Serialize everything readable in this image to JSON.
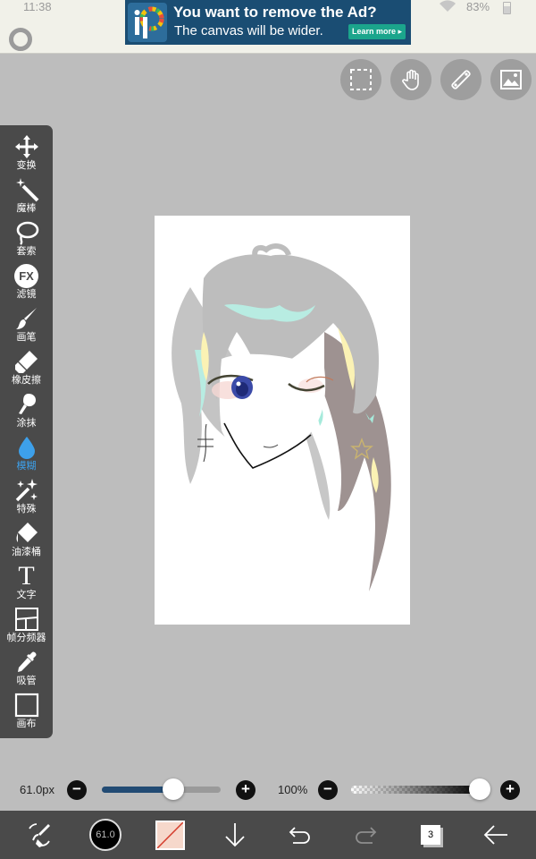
{
  "status_bar": {
    "time": "11:38",
    "battery": "83%"
  },
  "ad": {
    "title": "You want to remove the Ad?",
    "subtitle": "The canvas will be wider.",
    "button": "Learn more ▸"
  },
  "top_buttons": [
    {
      "name": "selection",
      "icon": "dashed-square-icon"
    },
    {
      "name": "gesture",
      "icon": "hand-icon"
    },
    {
      "name": "ruler",
      "icon": "ruler-icon"
    },
    {
      "name": "material",
      "icon": "image-icon"
    }
  ],
  "toolbar": {
    "items": [
      {
        "label": "变换",
        "icon": "move-arrows-icon"
      },
      {
        "label": "魔棒",
        "icon": "magic-wand-icon"
      },
      {
        "label": "套索",
        "icon": "lasso-icon"
      },
      {
        "label": "滤镜",
        "icon": "fx-icon",
        "icon_text": "FX"
      },
      {
        "label": "画笔",
        "icon": "brush-icon"
      },
      {
        "label": "橡皮擦",
        "icon": "eraser-icon"
      },
      {
        "label": "涂抹",
        "icon": "smudge-icon"
      },
      {
        "label": "模糊",
        "icon": "blur-drop-icon",
        "active": true
      },
      {
        "label": "特殊",
        "icon": "sparkle-icon"
      },
      {
        "label": "油漆桶",
        "icon": "bucket-icon"
      },
      {
        "label": "文字",
        "icon": "text-icon",
        "icon_text": "T"
      },
      {
        "label": "帧分频器",
        "icon": "frame-divider-icon"
      },
      {
        "label": "吸管",
        "icon": "eyedropper-icon"
      },
      {
        "label": "画布",
        "icon": "canvas-icon"
      }
    ],
    "active_color": "#3da0ea"
  },
  "brush_settings": {
    "size_label": "61.0px",
    "size_fraction": 0.6,
    "opacity_label": "100%",
    "opacity_fraction": 1.0,
    "minus": "−",
    "plus": "+"
  },
  "bottom_bar": {
    "brush_size_text": "61.0",
    "color": "#f6d8cb",
    "layer_count": "3"
  },
  "colors": {
    "toolbar_bg": "#4a4a4a",
    "app_bg": "#bdbdbd",
    "slider_fill": "#224b74"
  }
}
